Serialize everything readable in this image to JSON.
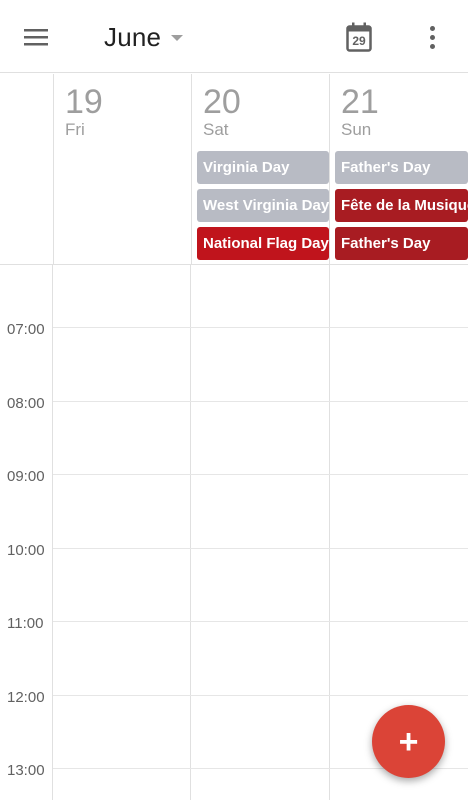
{
  "toolbar": {
    "month": "June",
    "today_date": "29"
  },
  "days": [
    {
      "number": "19",
      "name": "Fri",
      "events": []
    },
    {
      "number": "20",
      "name": "Sat",
      "events": [
        {
          "title": "Virginia Day",
          "color": "#b8bbc4"
        },
        {
          "title": "West Virginia Day",
          "color": "#b8bbc4"
        },
        {
          "title": "National Flag Day",
          "color": "#c0141c"
        }
      ]
    },
    {
      "number": "21",
      "name": "Sun",
      "events": [
        {
          "title": "Father's Day",
          "color": "#b8bbc4"
        },
        {
          "title": "Fête de la Musique",
          "color": "#a81c22"
        },
        {
          "title": "Father's Day",
          "color": "#a81c22"
        }
      ]
    }
  ],
  "hours": [
    "07:00",
    "08:00",
    "09:00",
    "10:00",
    "11:00",
    "12:00",
    "13:00"
  ],
  "colors": {
    "accent": "#db4437",
    "event_gray": "#b8bbc4",
    "event_red": "#c0141c",
    "event_dark_red": "#a81c22"
  }
}
